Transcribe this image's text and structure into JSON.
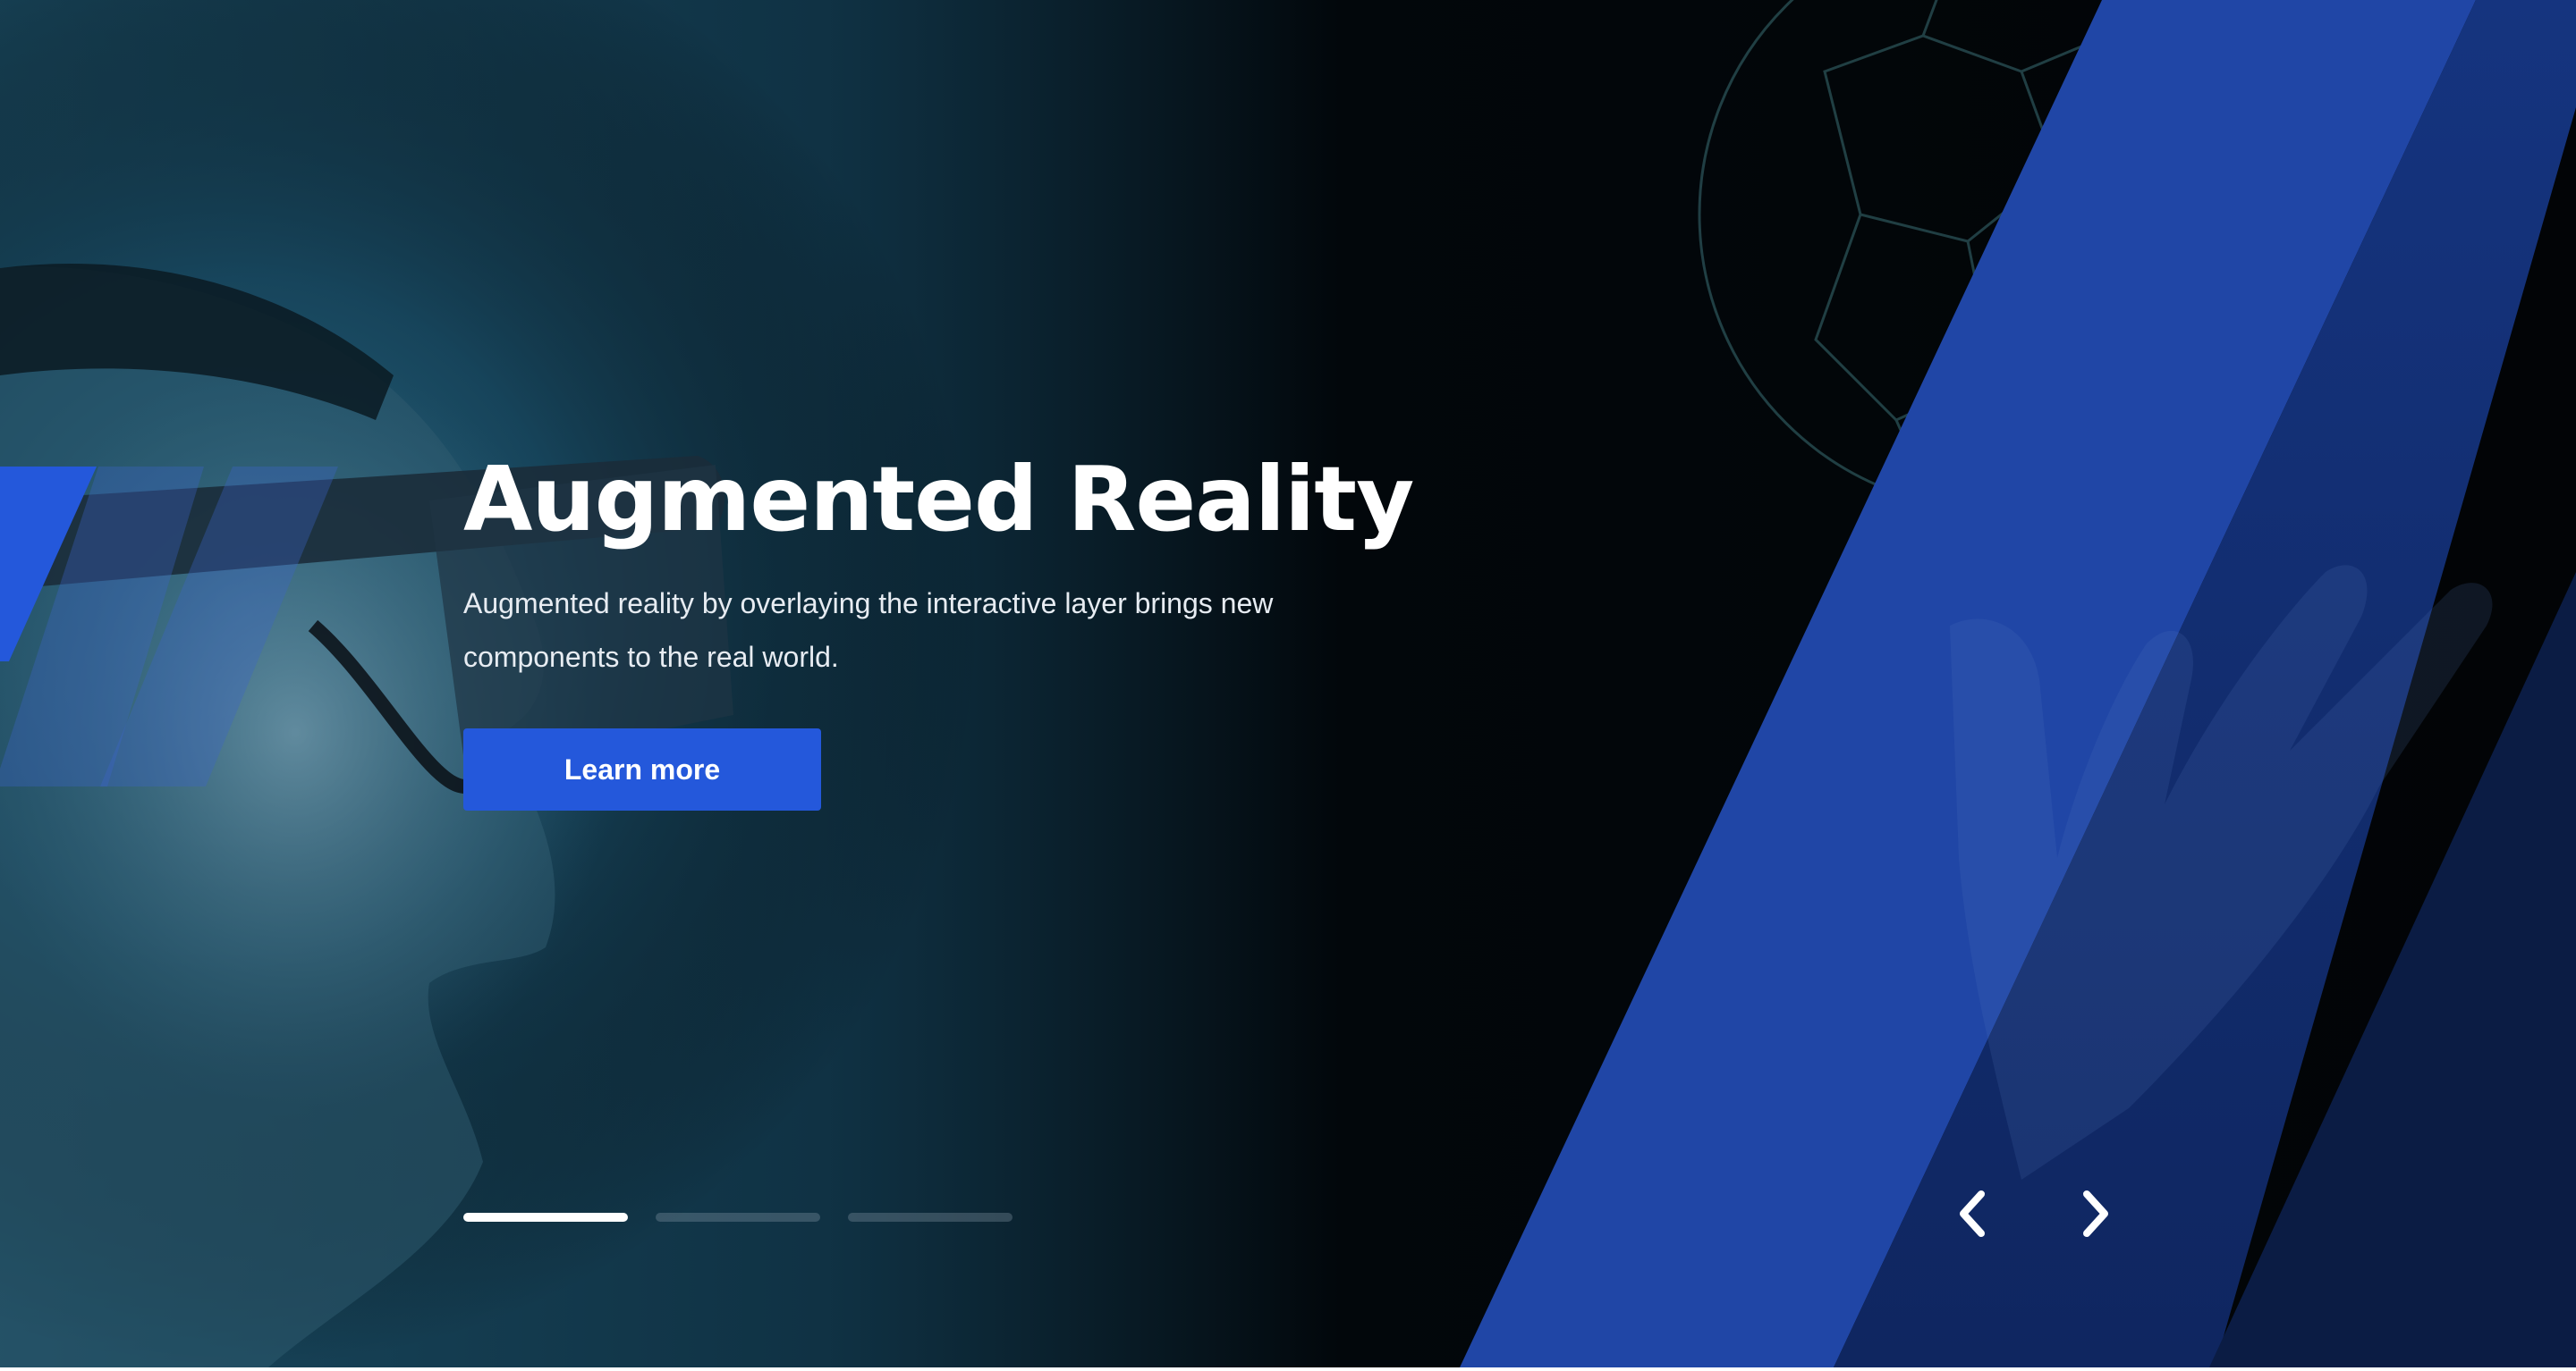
{
  "hero": {
    "title": "Augmented Reality",
    "description": "Augmented reality by overlaying the interactive layer brings new components to the real world.",
    "cta_label": "Learn more",
    "slides_total": 3,
    "active_slide": 1
  },
  "navigation": {
    "prev_icon": "chevron-left-icon",
    "next_icon": "chevron-right-icon"
  },
  "colors": {
    "accent": "#2458db",
    "stripe_blue": "#1f45a6",
    "background_dark": "#020406",
    "photo_tint": "#1b4a63"
  }
}
